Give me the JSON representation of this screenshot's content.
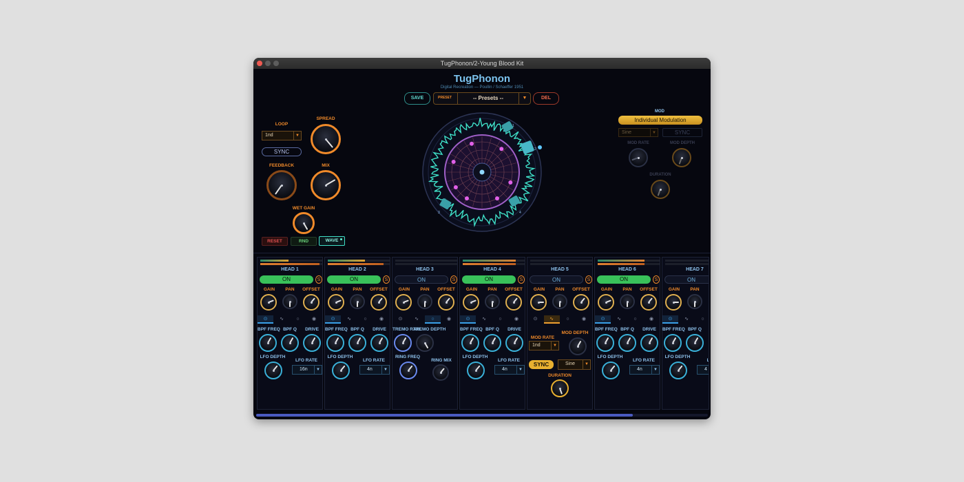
{
  "window": {
    "title": "TugPhonon/2-Young Blood Kit"
  },
  "app": {
    "title": "TugPhonon",
    "subtitle": "Digital Recreation  —  Poullin / Schaeffer  1951"
  },
  "top": {
    "save": "SAVE",
    "preset_tag": "PRESET",
    "preset_value": "-- Presets --",
    "delete": "DEL"
  },
  "left_panel": {
    "loop_label": "LOOP",
    "loop_value": "1nd",
    "sync": "SYNC",
    "spread_label": "SPREAD",
    "feedback_label": "FEEDBACK",
    "mix_label": "MIX",
    "wet_gain_label": "WET GAIN",
    "reset": "RESET",
    "rnd": "RND",
    "wave": "WAVE"
  },
  "wheel": {
    "markers": [
      "1",
      "2",
      "3",
      "4"
    ]
  },
  "mod_panel": {
    "mod_label": "MOD",
    "individual_modulation": "Individual Modulation",
    "wave_value": "Sine",
    "sync": "SYNC",
    "mod_rate_label": "MOD RATE",
    "mod_depth_label": "MOD DEPTH",
    "duration_label": "DURATION"
  },
  "heads": [
    {
      "title": "HEAD 1",
      "state": "ON",
      "solo": "S",
      "gain": "GAIN",
      "pan": "PAN",
      "offset": "OFFSET",
      "p1": "BPF FREQ",
      "p2": "BPF Q",
      "p3": "DRIVE",
      "p4": "LFO DEPTH",
      "p5": "LFO RATE",
      "rate": "16n"
    },
    {
      "title": "HEAD 2",
      "state": "ON",
      "solo": "S",
      "gain": "GAIN",
      "pan": "PAN",
      "offset": "OFFSET",
      "p1": "BPF FREQ",
      "p2": "BPF Q",
      "p3": "DRIVE",
      "p4": "LFO DEPTH",
      "p5": "LFO RATE",
      "rate": "4n"
    },
    {
      "title": "HEAD 3",
      "state": "ON",
      "solo": "S",
      "gain": "GAIN",
      "pan": "PAN",
      "offset": "OFFSET",
      "p1": "TREMO RATE",
      "p2": "TREMO DEPTH",
      "p4": "RING FREQ",
      "p5": "RING MIX"
    },
    {
      "title": "HEAD 4",
      "state": "ON",
      "solo": "S",
      "gain": "GAIN",
      "pan": "PAN",
      "offset": "OFFSET",
      "p1": "BPF FREQ",
      "p2": "BPF Q",
      "p3": "DRIVE",
      "p4": "LFO DEPTH",
      "p5": "LFO RATE",
      "rate": "4n"
    },
    {
      "title": "HEAD 5",
      "state": "ON",
      "solo": "S",
      "gain": "GAIN",
      "pan": "PAN",
      "offset": "OFFSET",
      "p1": "MOD RATE",
      "p2": "MOD DEPTH",
      "rate_value": "1nd",
      "sync": "SYNC",
      "wave": "Sine",
      "duration": "DURATION"
    },
    {
      "title": "HEAD 6",
      "state": "ON",
      "solo": "S",
      "gain": "GAIN",
      "pan": "PAN",
      "offset": "OFFSET",
      "p1": "BPF FREQ",
      "p2": "BPF Q",
      "p3": "DRIVE",
      "p4": "LFO DEPTH",
      "p5": "LFO RATE",
      "rate": "4n"
    },
    {
      "title": "HEAD 7",
      "state": "ON",
      "gain": "GAIN",
      "pan": "PAN",
      "p1": "BPF FREQ",
      "p2": "BPF Q",
      "p4": "LFO DEPTH",
      "p5": "LFC",
      "rate": "4"
    }
  ],
  "colors": {
    "accent_orange": "#f08a2a",
    "accent_blue": "#3aa0e8",
    "on_green": "#39c15a",
    "wave_cyan": "#3fe0c8",
    "sync_gold": "#e8b030"
  }
}
